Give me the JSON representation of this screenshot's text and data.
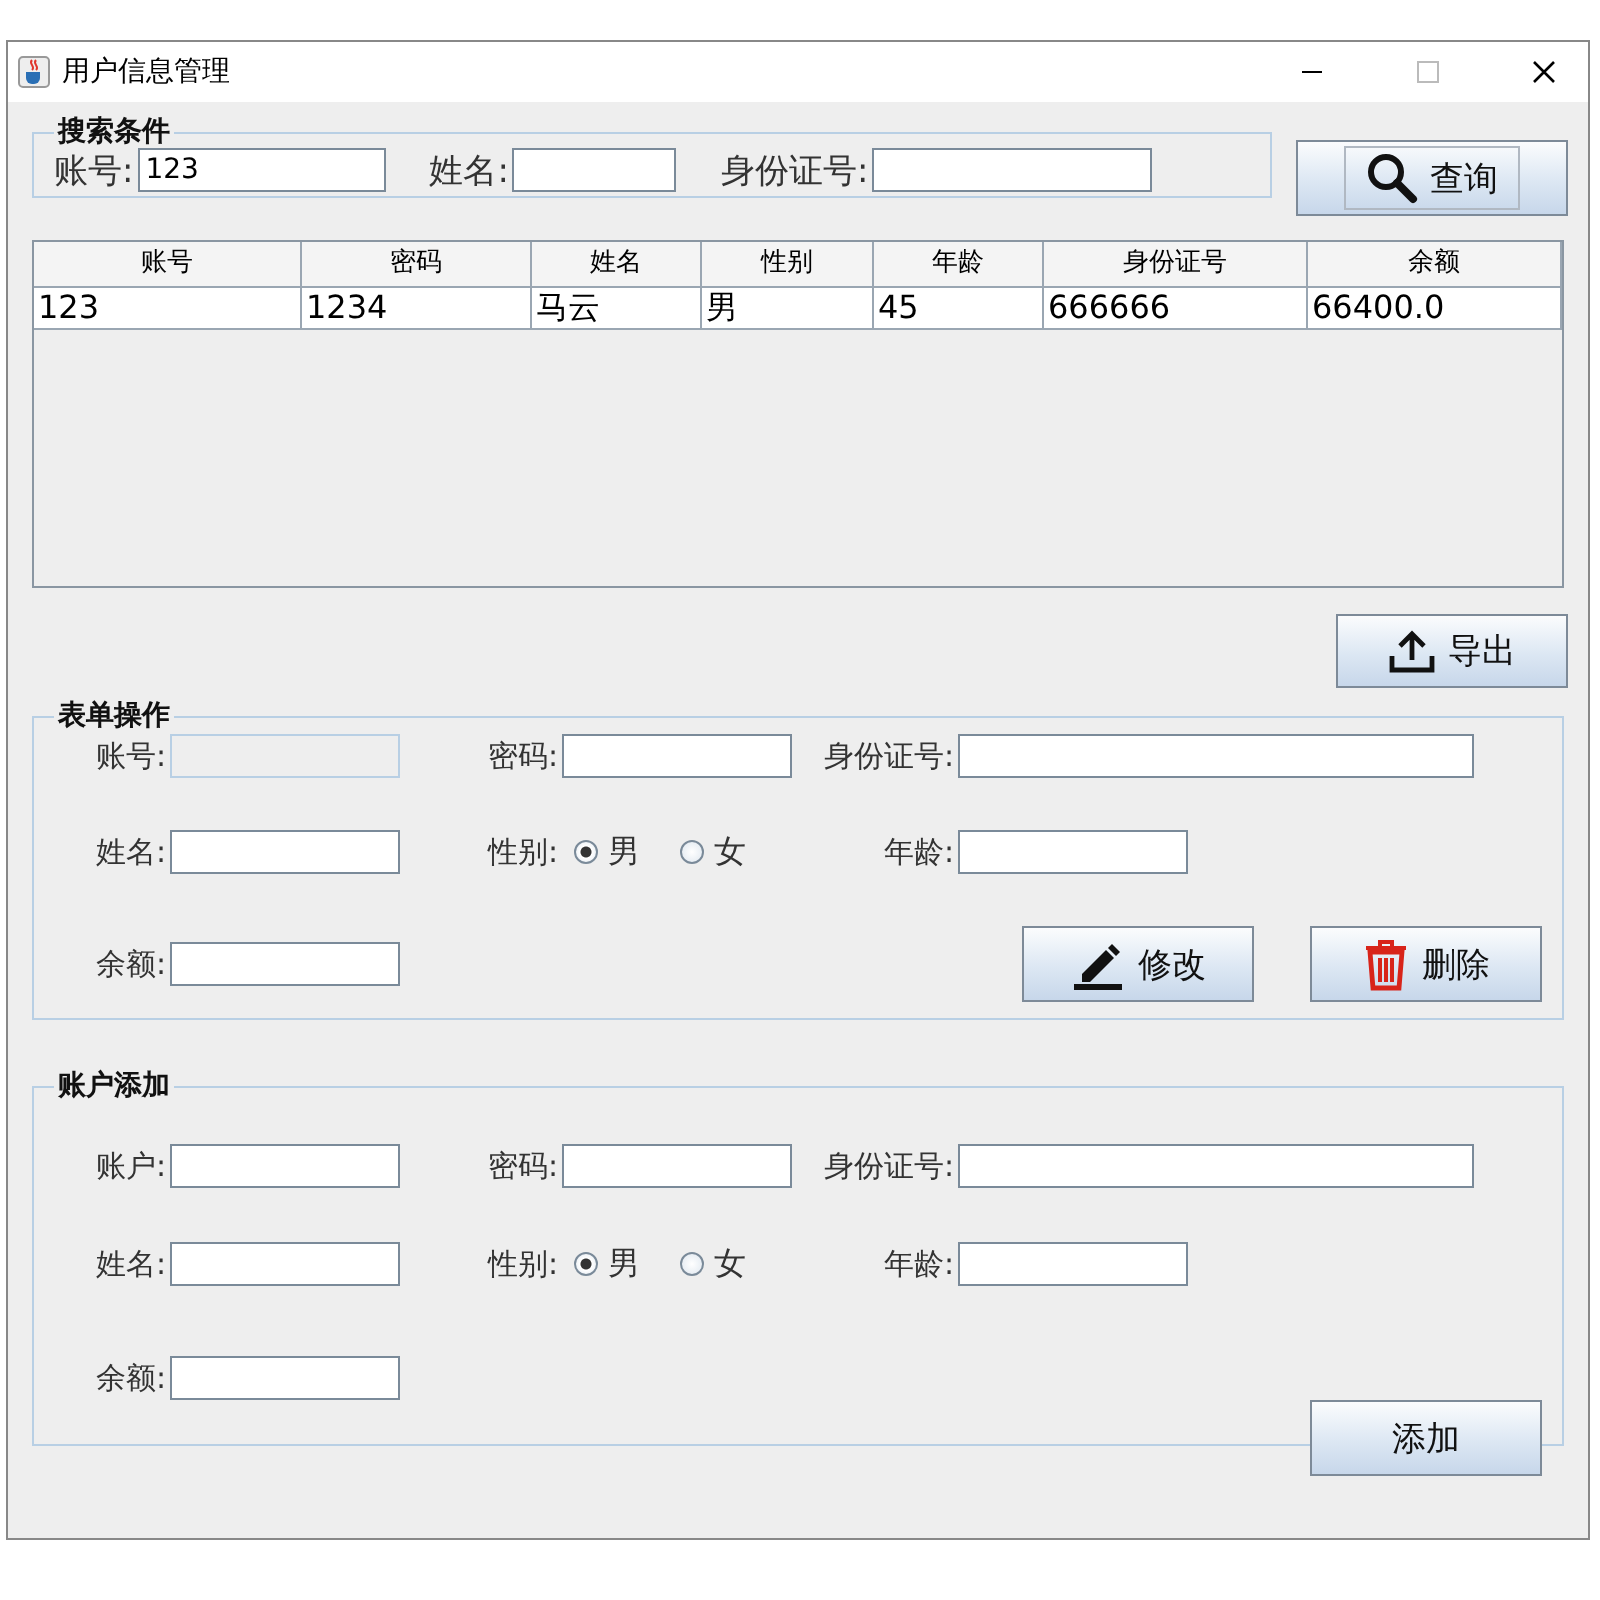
{
  "window": {
    "title": "用户信息管理"
  },
  "search": {
    "legend": "搜索条件",
    "fields": [
      {
        "label": "账号:",
        "value": "123"
      },
      {
        "label": "姓名:"
      },
      {
        "label": "身份证号:"
      }
    ],
    "button": {
      "label": "查询",
      "kind": "search"
    }
  },
  "table": {
    "columns": [
      "账号",
      "密码",
      "姓名",
      "性别",
      "年龄",
      "身份证号",
      "余额"
    ],
    "rows": [
      [
        "123",
        "1234",
        "马云",
        "男",
        "45",
        "666666",
        "66400.0"
      ]
    ]
  },
  "export_button": {
    "label": "导出",
    "kind": "export"
  },
  "forms": [
    {
      "legend": "表单操作",
      "rows": [
        [
          {
            "kind": "text",
            "label": "账号:",
            "disabled": true
          },
          {
            "kind": "text",
            "label": "密码:",
            "disabled": false
          },
          {
            "kind": "wide",
            "label": "身份证号:",
            "disabled": false
          }
        ],
        [
          {
            "kind": "text",
            "label": "姓名:",
            "disabled": false
          },
          {
            "kind": "radio",
            "label": "性别:",
            "options": [
              {
                "label": "男",
                "selected": true
              },
              {
                "label": "女",
                "selected": false
              }
            ]
          },
          {
            "kind": "text",
            "label": "年龄:",
            "disabled": false
          }
        ],
        [
          {
            "kind": "text",
            "label": "余额:",
            "disabled": false
          }
        ]
      ],
      "buttons": [
        {
          "label": "修改",
          "kind": "edit"
        },
        {
          "label": "删除",
          "kind": "delete"
        }
      ]
    },
    {
      "legend": "账户添加",
      "rows": [
        [
          {
            "kind": "text",
            "label": "账户:",
            "disabled": false
          },
          {
            "kind": "text",
            "label": "密码:",
            "disabled": false
          },
          {
            "kind": "wide",
            "label": "身份证号:",
            "disabled": false
          }
        ],
        [
          {
            "kind": "text",
            "label": "姓名:",
            "disabled": false
          },
          {
            "kind": "radio",
            "label": "性别:",
            "options": [
              {
                "label": "男",
                "selected": true
              },
              {
                "label": "女",
                "selected": false
              }
            ]
          },
          {
            "kind": "text",
            "label": "年龄:",
            "disabled": false
          }
        ],
        [
          {
            "kind": "text",
            "label": "余额:",
            "disabled": false
          }
        ]
      ],
      "buttons": [
        {
          "label": "添加",
          "kind": "add"
        }
      ]
    }
  ]
}
